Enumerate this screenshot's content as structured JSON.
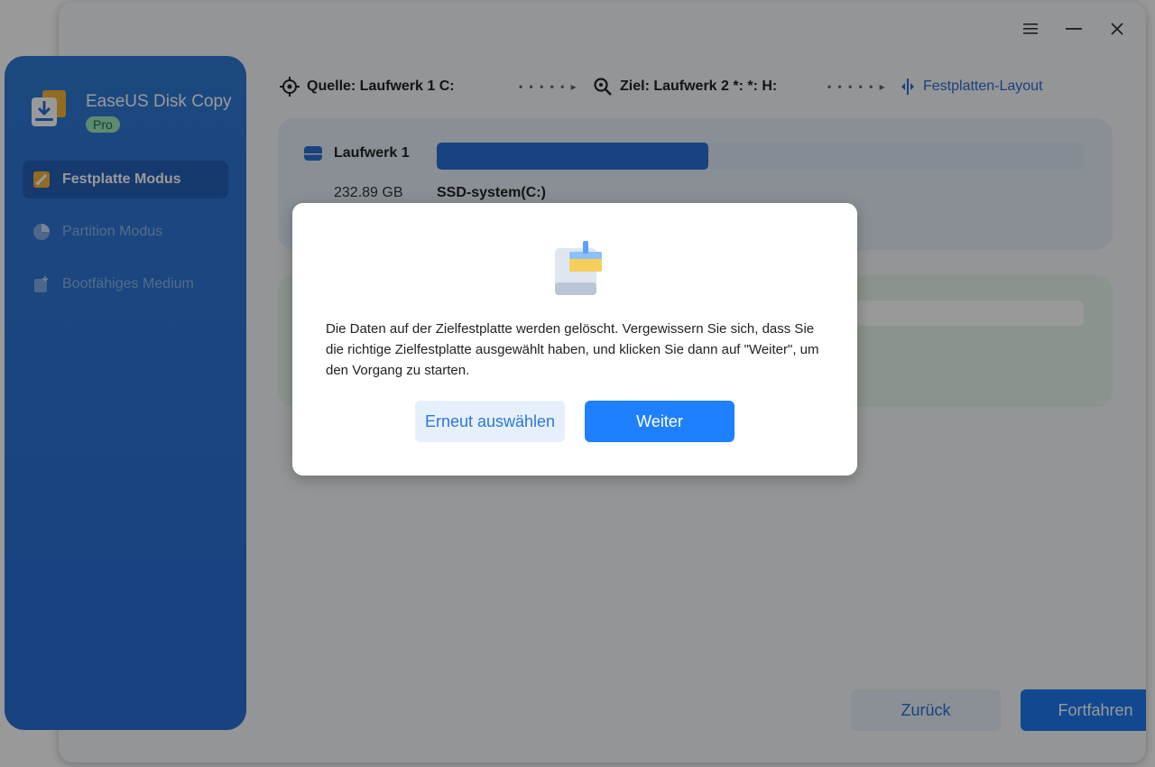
{
  "app": {
    "name": "EaseUS Disk Copy",
    "edition": "Pro"
  },
  "sidebar": {
    "items": [
      {
        "label": "Festplatte Modus",
        "active": true
      },
      {
        "label": "Partition Modus",
        "active": false
      },
      {
        "label": "Bootfähiges Medium",
        "active": false
      }
    ]
  },
  "topbar": {
    "source_label": "Quelle: Laufwerk 1 C:",
    "target_label": "Ziel: Laufwerk 2 *: *: H:",
    "layout_link": "Festplatten-Layout"
  },
  "source_disk": {
    "name": "Laufwerk 1",
    "size": "232.89 GB",
    "partition": "SSD-system(C:)",
    "used_fraction": 0.42
  },
  "footer": {
    "back_label": "Zurück",
    "continue_label": "Fortfahren"
  },
  "dialog": {
    "message": "Die Daten auf der Zielfestplatte werden gelöscht. Vergewissern Sie sich, dass Sie die richtige Zielfestplatte ausgewählt haben, und klicken Sie dann auf \"Weiter\", um den Vorgang zu starten.",
    "reselect_label": "Erneut auswählen",
    "continue_label": "Weiter"
  },
  "colors": {
    "accent": "#1f80ff",
    "sidebar": "#2a6fd6",
    "pro_badge": "#9be6bf"
  }
}
